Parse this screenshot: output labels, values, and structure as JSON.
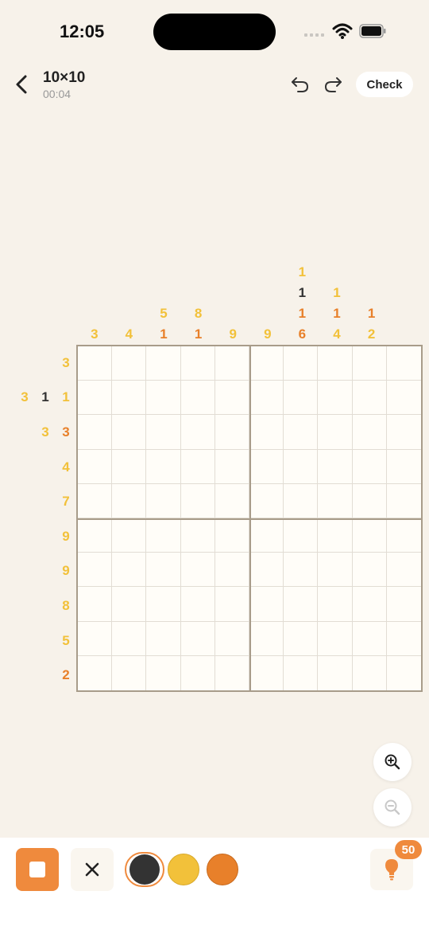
{
  "status": {
    "time": "12:05"
  },
  "header": {
    "title": "10×10",
    "timer": "00:04",
    "check_label": "Check"
  },
  "colors": {
    "yellow": "#f2c13a",
    "orange": "#e8802a",
    "black": "#333333",
    "accent": "#ef8a3d"
  },
  "column_clues": [
    [
      {
        "v": "3",
        "c": "yellow"
      }
    ],
    [
      {
        "v": "4",
        "c": "yellow"
      }
    ],
    [
      {
        "v": "5",
        "c": "yellow"
      },
      {
        "v": "1",
        "c": "orange"
      }
    ],
    [
      {
        "v": "8",
        "c": "yellow"
      },
      {
        "v": "1",
        "c": "orange"
      }
    ],
    [
      {
        "v": "9",
        "c": "yellow"
      }
    ],
    [
      {
        "v": "9",
        "c": "yellow"
      }
    ],
    [
      {
        "v": "1",
        "c": "yellow"
      },
      {
        "v": "1",
        "c": "black"
      },
      {
        "v": "1",
        "c": "orange"
      },
      {
        "v": "6",
        "c": "orange"
      }
    ],
    [
      {
        "v": "1",
        "c": "yellow"
      },
      {
        "v": "1",
        "c": "orange"
      },
      {
        "v": "4",
        "c": "yellow"
      }
    ],
    [
      {
        "v": "1",
        "c": "orange"
      },
      {
        "v": "2",
        "c": "yellow"
      }
    ],
    []
  ],
  "row_clues": [
    [
      {
        "v": "3",
        "c": "yellow"
      }
    ],
    [
      {
        "v": "3",
        "c": "yellow"
      },
      {
        "v": "1",
        "c": "black"
      },
      {
        "v": "1",
        "c": "yellow"
      }
    ],
    [
      {
        "v": "3",
        "c": "yellow"
      },
      {
        "v": "3",
        "c": "orange"
      }
    ],
    [
      {
        "v": "4",
        "c": "yellow"
      }
    ],
    [
      {
        "v": "7",
        "c": "yellow"
      }
    ],
    [
      {
        "v": "9",
        "c": "yellow"
      }
    ],
    [
      {
        "v": "9",
        "c": "yellow"
      }
    ],
    [
      {
        "v": "8",
        "c": "yellow"
      }
    ],
    [
      {
        "v": "5",
        "c": "yellow"
      }
    ],
    [
      {
        "v": "2",
        "c": "orange"
      }
    ]
  ],
  "grid": {
    "rows": 10,
    "cols": 10
  },
  "palette": {
    "selected": "black",
    "options": [
      "black",
      "yellow",
      "orange"
    ]
  },
  "hint": {
    "count": "50"
  },
  "icons": [
    "chevron-left-icon",
    "undo-icon",
    "redo-icon",
    "zoom-in-icon",
    "zoom-out-icon",
    "square-fill-icon",
    "cross-icon",
    "lightbulb-icon",
    "wifi-icon",
    "battery-icon"
  ]
}
